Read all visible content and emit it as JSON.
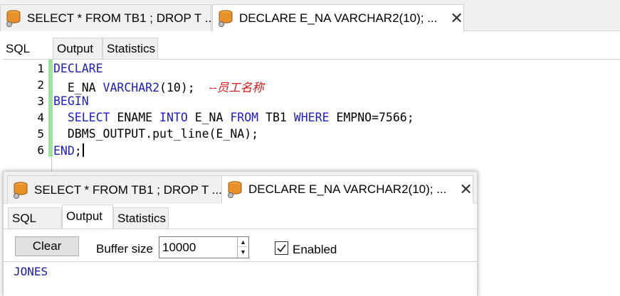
{
  "doc_tabs": [
    {
      "label": "SELECT * FROM TB1 ; DROP T ...",
      "active": false
    },
    {
      "label": "DECLARE E_NA VARCHAR2(10); ...",
      "active": true
    }
  ],
  "sub_tabs": [
    "SQL",
    "Output",
    "Statistics"
  ],
  "active_sub_tab": "SQL",
  "editor": {
    "line_numbers": [
      "1",
      "2",
      "3",
      "4",
      "5",
      "6"
    ],
    "lines": [
      [
        {
          "t": "DECLARE",
          "c": "kw"
        }
      ],
      [
        {
          "t": "  E_NA ",
          "c": "fn"
        },
        {
          "t": "VARCHAR2",
          "c": "ty"
        },
        {
          "t": "(10);  ",
          "c": "fn"
        },
        {
          "t": "--员工名称",
          "c": "cm"
        }
      ],
      [
        {
          "t": "BEGIN",
          "c": "kw"
        }
      ],
      [
        {
          "t": "  SELECT ",
          "c": "kw"
        },
        {
          "t": "ENAME ",
          "c": "fn"
        },
        {
          "t": "INTO ",
          "c": "kw"
        },
        {
          "t": "E_NA ",
          "c": "fn"
        },
        {
          "t": "FROM ",
          "c": "kw"
        },
        {
          "t": "TB1 ",
          "c": "fn"
        },
        {
          "t": "WHERE ",
          "c": "kw"
        },
        {
          "t": "EMPNO=7566;",
          "c": "fn"
        }
      ],
      [
        {
          "t": "  DBMS_OUTPUT.put_line(E_NA);",
          "c": "fn"
        }
      ],
      [
        {
          "t": "END",
          "c": "kw"
        },
        {
          "t": ";",
          "c": "fn"
        }
      ]
    ]
  },
  "overlay": {
    "doc_tabs": [
      {
        "label": "SELECT * FROM TB1 ; DROP T ...",
        "active": false
      },
      {
        "label": "DECLARE E_NA VARCHAR2(10); ...",
        "active": true
      }
    ],
    "sub_tabs": [
      "SQL",
      "Output",
      "Statistics"
    ],
    "active_sub_tab": "Output",
    "toolbar": {
      "clear_label": "Clear",
      "buffer_label": "Buffer size",
      "buffer_value": "10000",
      "enabled_label": "Enabled",
      "enabled_checked": true
    },
    "output_lines": [
      "JONES"
    ]
  },
  "icons": {
    "doc_tab_icon": "database-icon",
    "close": "close-icon",
    "spin_up": "spin-up-icon",
    "spin_down": "spin-down-icon",
    "check": "checkmark-icon"
  },
  "colors": {
    "keyword": "#2020b8",
    "comment": "#d81818",
    "change_bar": "#9fe09f",
    "output_text": "#1a1aa0"
  }
}
